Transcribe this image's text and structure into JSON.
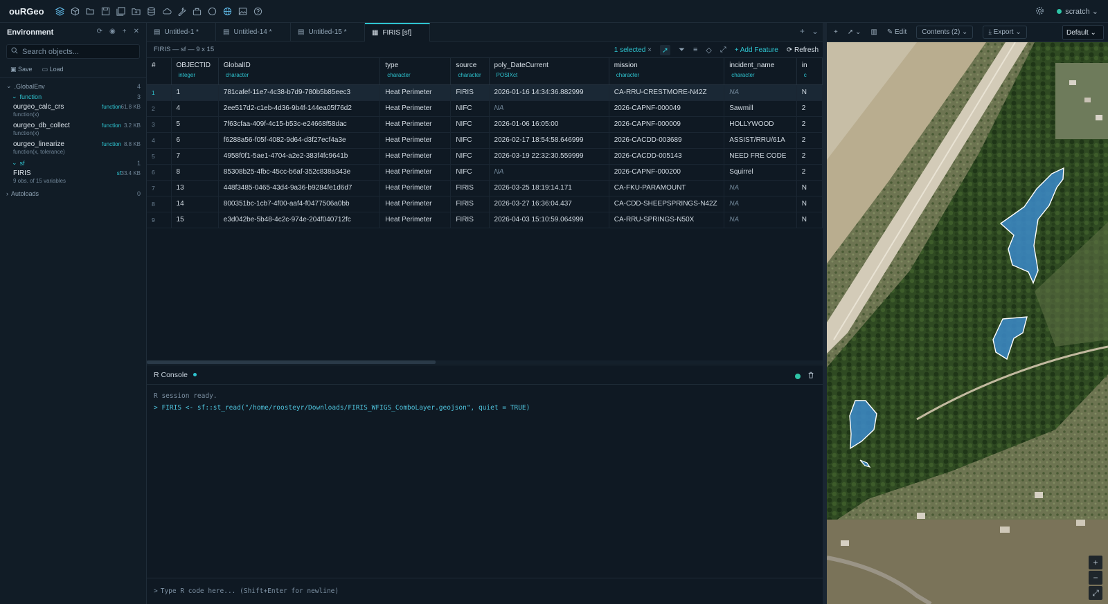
{
  "app": {
    "title": "ouRGeo",
    "workspace": "scratch",
    "toolbar_icons": [
      "layers-icon",
      "cube-icon",
      "folder-open-icon",
      "save-icon",
      "save-all-icon",
      "folder-icon",
      "database-icon",
      "cloud-icon",
      "wrench-icon",
      "package-icon",
      "circle-icon",
      "globe-icon",
      "image-icon",
      "help-icon"
    ]
  },
  "sidebar": {
    "title": "Environment",
    "search_placeholder": "Search objects...",
    "save_label": "Save",
    "load_label": "Load",
    "global_env": {
      "label": ".GlobalEnv",
      "count": "4"
    },
    "function_group": {
      "label": "function",
      "count": "3"
    },
    "functions": [
      {
        "name": "ourgeo_calc_crs",
        "sig": "function(x)",
        "type": "function",
        "size": "61.8 KB"
      },
      {
        "name": "ourgeo_db_collect",
        "sig": "function(x)",
        "type": "function",
        "size": "3.2 KB"
      },
      {
        "name": "ourgeo_linearize",
        "sig": "function(x, tolerance)",
        "type": "function",
        "size": "8.8 KB"
      }
    ],
    "sf_group": {
      "label": "sf",
      "count": "1"
    },
    "sf_objects": [
      {
        "name": "FIRIS",
        "sig": "9 obs. of 15 variables",
        "type": "sf",
        "size": "33.4 KB"
      }
    ],
    "autoloads": {
      "label": "Autoloads",
      "count": "0"
    }
  },
  "tabs": [
    {
      "label": "Untitled-1 *",
      "active": false
    },
    {
      "label": "Untitled-14 *",
      "active": false
    },
    {
      "label": "Untitled-15 *",
      "active": false
    },
    {
      "label": "FIRIS [sf]",
      "active": true
    }
  ],
  "table_toolbar": {
    "summary": "FIRIS — sf — 9 x 15",
    "selected": "1 selected",
    "add_feature": "Add Feature",
    "refresh": "Refresh"
  },
  "table": {
    "columns": [
      {
        "name": "#",
        "type": ""
      },
      {
        "name": "OBJECTID",
        "type": "integer"
      },
      {
        "name": "GlobalID",
        "type": "character"
      },
      {
        "name": "type",
        "type": "character"
      },
      {
        "name": "source",
        "type": "character"
      },
      {
        "name": "poly_DateCurrent",
        "type": "POSIXct"
      },
      {
        "name": "mission",
        "type": "character"
      },
      {
        "name": "incident_name",
        "type": "character"
      },
      {
        "name": "in",
        "type": "c"
      }
    ],
    "rows": [
      [
        "1",
        "1",
        "781cafef-11e7-4c38-b7d9-780b5b85eec3",
        "Heat Perimeter",
        "FIRIS",
        "2026-01-16 14:34:36.882999",
        "CA-RRU-CRESTMORE-N42Z",
        "NA",
        "N"
      ],
      [
        "2",
        "4",
        "2ee517d2-c1eb-4d36-9b4f-144ea05f76d2",
        "Heat Perimeter",
        "NIFC",
        "NA",
        "2026-CAPNF-000049",
        "Sawmill",
        "2"
      ],
      [
        "3",
        "5",
        "7f63cfaa-409f-4c15-b53c-e24668f58dac",
        "Heat Perimeter",
        "NIFC",
        "2026-01-06 16:05:00",
        "2026-CAPNF-000009",
        "HOLLYWOOD",
        "2"
      ],
      [
        "4",
        "6",
        "f6288a56-f05f-4082-9d64-d3f27ecf4a3e",
        "Heat Perimeter",
        "NIFC",
        "2026-02-17 18:54:58.646999",
        "2026-CACDD-003689",
        "ASSIST/RRU/61A",
        "2"
      ],
      [
        "5",
        "7",
        "4958f0f1-5ae1-4704-a2e2-383f4fc9641b",
        "Heat Perimeter",
        "NIFC",
        "2026-03-19 22:32:30.559999",
        "2026-CACDD-005143",
        "NEED FRE CODE",
        "2"
      ],
      [
        "6",
        "8",
        "85308b25-4fbc-45cc-b6af-352c838a343e",
        "Heat Perimeter",
        "NIFC",
        "NA",
        "2026-CAPNF-000200",
        "Squirrel",
        "2"
      ],
      [
        "7",
        "13",
        "448f3485-0465-43d4-9a36-b9284fe1d6d7",
        "Heat Perimeter",
        "FIRIS",
        "2026-03-25 18:19:14.171",
        "CA-FKU-PARAMOUNT",
        "NA",
        "N"
      ],
      [
        "8",
        "14",
        "800351bc-1cb7-4f00-aaf4-f0477506a0bb",
        "Heat Perimeter",
        "FIRIS",
        "2026-03-27 16:36:04.437",
        "CA-CDD-SHEEPSPRINGS-N42Z",
        "NA",
        "N"
      ],
      [
        "9",
        "15",
        "e3d042be-5b48-4c2c-974e-204f040712fc",
        "Heat Perimeter",
        "FIRIS",
        "2026-04-03 15:10:59.064999",
        "CA-RRU-SPRINGS-N50X",
        "NA",
        "N"
      ]
    ],
    "selected_row": 0
  },
  "console": {
    "title": "R Console",
    "ready": "R session ready.",
    "command": "> FIRIS <- sf::st_read(\"/home/roosteyr/Downloads/FIRIS_WFIGS_ComboLayer.geojson\", quiet = TRUE)",
    "prompt": ">",
    "input_placeholder": "Type R code here... (Shift+Enter for newline)"
  },
  "map": {
    "edit_label": "Edit",
    "contents_label": "Contents (2)",
    "export_label": "Export",
    "basemap": "Default",
    "polygon_color": "#3b87c4",
    "accent": "#2ec4d0"
  }
}
